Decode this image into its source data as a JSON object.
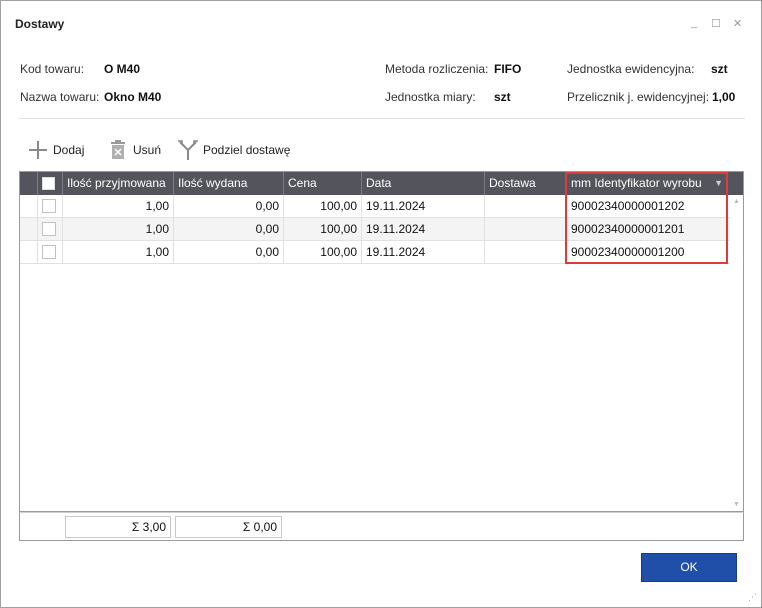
{
  "window": {
    "title": "Dostawy",
    "minimize": "_",
    "maximize": "☐",
    "close": "✕"
  },
  "info": {
    "kod_label": "Kod towaru:",
    "kod_value": "O M40",
    "nazwa_label": "Nazwa towaru:",
    "nazwa_value": "Okno M40",
    "metoda_label": "Metoda rozliczenia:",
    "metoda_value": "FIFO",
    "jm_label": "Jednostka miary:",
    "jm_value": "szt",
    "jedn_ewid_label": "Jednostka ewidencyjna:",
    "jedn_ewid_value": "szt",
    "przelicznik_label": "Przelicznik j. ewidencyjnej:",
    "przelicznik_value": "1,00"
  },
  "toolbar": {
    "add_label": "Dodaj",
    "remove_label": "Usuń",
    "split_label": "Podziel dostawę"
  },
  "grid": {
    "columns": [
      "Ilość przyjmowana",
      "Ilość wydana",
      "Cena",
      "Data",
      "Dostawa",
      "mm Identyfikator wyrobu"
    ],
    "rows": [
      {
        "przyjmowana": "1,00",
        "wydana": "0,00",
        "cena": "100,00",
        "data": "19.11.2024",
        "dostawa": "",
        "identyfikator": "90002340000001202"
      },
      {
        "przyjmowana": "1,00",
        "wydana": "0,00",
        "cena": "100,00",
        "data": "19.11.2024",
        "dostawa": "",
        "identyfikator": "90002340000001201"
      },
      {
        "przyjmowana": "1,00",
        "wydana": "0,00",
        "cena": "100,00",
        "data": "19.11.2024",
        "dostawa": "",
        "identyfikator": "90002340000001200"
      }
    ]
  },
  "footer": {
    "sum_przyjmowana": "Σ 3,00",
    "sum_wydana": "Σ 0,00"
  },
  "buttons": {
    "ok": "OK"
  },
  "colors": {
    "header_bg": "#54545c",
    "ok_button": "#1f4fa8",
    "highlight": "#e03a3a"
  }
}
